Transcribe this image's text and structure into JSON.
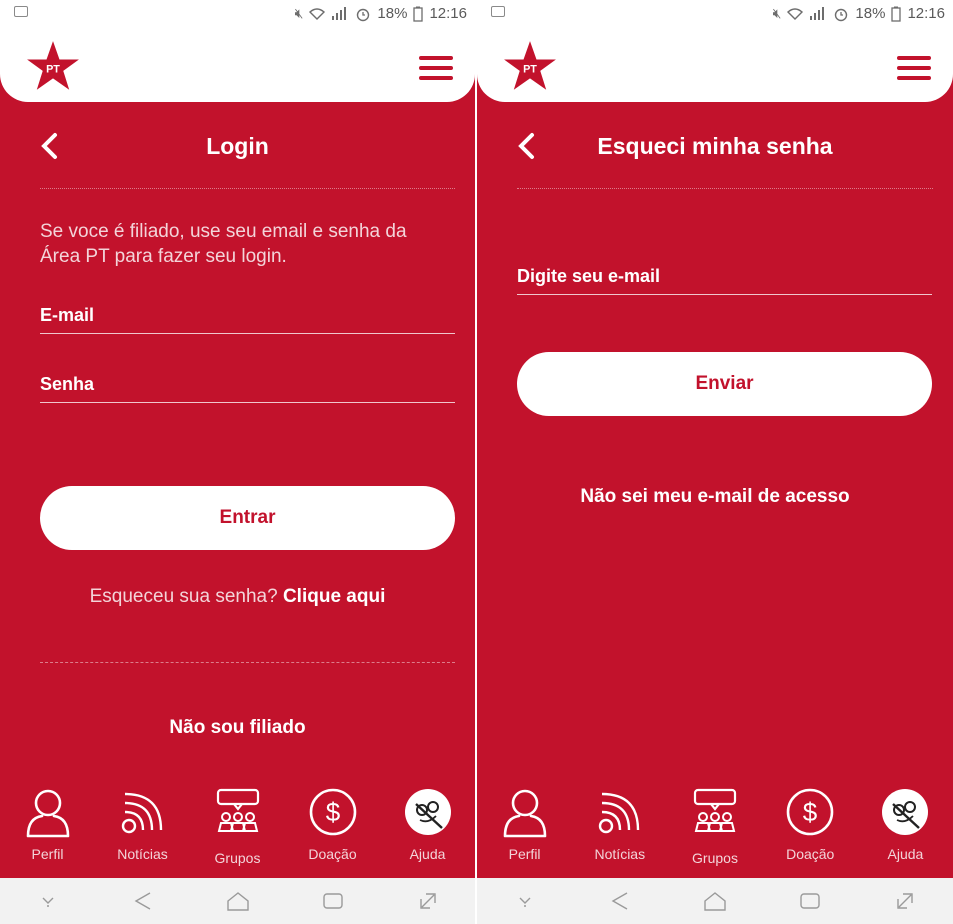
{
  "colors": {
    "brand_red": "#C2122C",
    "white": "#FFFFFF"
  },
  "statusbar": {
    "battery": "18%",
    "time": "12:16"
  },
  "logo": {
    "text": "PT"
  },
  "nav": [
    {
      "label": "Perfil",
      "icon": "user-icon"
    },
    {
      "label": "Notícias",
      "icon": "rss-icon"
    },
    {
      "label": "Grupos",
      "icon": "groups-icon"
    },
    {
      "label": "Doação",
      "icon": "donation-icon"
    },
    {
      "label": "Ajuda",
      "icon": "help-icon"
    }
  ],
  "login": {
    "title": "Login",
    "intro": "Se voce é filiado, use seu email e senha da Área PT para fazer seu login.",
    "email_placeholder": "E-mail",
    "password_placeholder": "Senha",
    "submit_label": "Entrar",
    "forgot_prefix": "Esqueceu sua senha?",
    "forgot_link": "Clique aqui",
    "not_member_link": "Não sou filiado"
  },
  "forgot_password": {
    "title": "Esqueci minha senha",
    "email_placeholder": "Digite seu e-mail",
    "submit_label": "Enviar",
    "unknown_email_link": "Não sei meu e-mail de acesso"
  }
}
